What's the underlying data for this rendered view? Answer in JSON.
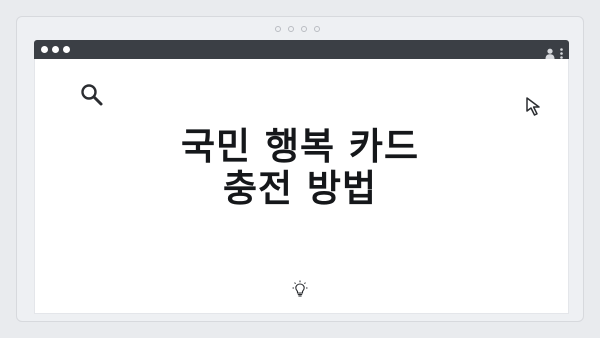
{
  "title_line1": "국민 행복 카드",
  "title_line2": "충전 방법",
  "colors": {
    "background": "#e9ebee",
    "browser_bar": "#3b3f45",
    "content_bg": "#ffffff",
    "title_text": "#15171a"
  },
  "icons": {
    "top_left": "search-icon",
    "top_right": "cursor-arrow-icon",
    "bottom_center": "lightbulb-icon",
    "bar_right": [
      "user-icon",
      "kebab-menu-icon"
    ]
  }
}
